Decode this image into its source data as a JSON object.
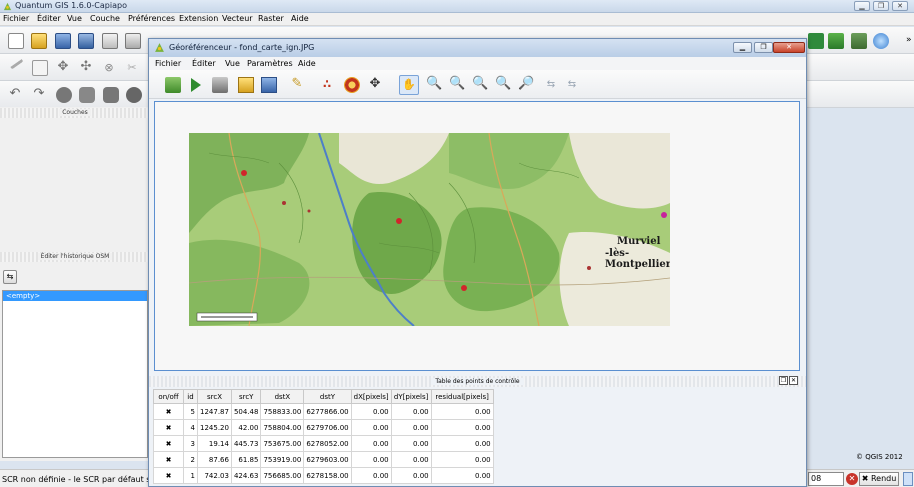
{
  "main_window": {
    "title": "Quantum GIS 1.6.0-Capiapo",
    "buttons": [
      "▁",
      "❐",
      "✕"
    ]
  },
  "main_menu": [
    "Fichier",
    "Éditer",
    "Vue",
    "Couche",
    "Préférences",
    "Extension",
    "Vecteur",
    "Raster",
    "Aide"
  ],
  "panels": {
    "layers_title": "Couches",
    "osm_title": "Éditer l'historique OSM",
    "osm_list_item": "<empty>"
  },
  "status": {
    "left_text": "SCR non définie - le SCR par défaut ser",
    "copyright": "© QGIS 2012",
    "scale_value": "08",
    "render_label": "Rendu"
  },
  "georef": {
    "title": "Géoréférenceur - fond_carte_ign.JPG",
    "menu": [
      "Fichier",
      "Éditer",
      "Vue",
      "Paramètres",
      "Aide"
    ],
    "table_title": "Table des points de contrôle",
    "columns": [
      "on/off",
      "id",
      "srcX",
      "srcY",
      "dstX",
      "dstY",
      "dX[pixels]",
      "dY[pixels]",
      "residual[pixels]"
    ],
    "rows": [
      [
        "✖",
        "5",
        "1247.87",
        "504.48",
        "758833.00",
        "6277866.00",
        "0.00",
        "0.00",
        "0.00"
      ],
      [
        "✖",
        "4",
        "1245.20",
        "42.00",
        "758804.00",
        "6279706.00",
        "0.00",
        "0.00",
        "0.00"
      ],
      [
        "✖",
        "3",
        "19.14",
        "445.73",
        "753675.00",
        "6278052.00",
        "0.00",
        "0.00",
        "0.00"
      ],
      [
        "✖",
        "2",
        "87.66",
        "61.85",
        "753919.00",
        "6279603.00",
        "0.00",
        "0.00",
        "0.00"
      ],
      [
        "✖",
        "1",
        "742.03",
        "424.63",
        "756685.00",
        "6278158.00",
        "0.00",
        "0.00",
        "0.00"
      ]
    ]
  },
  "map": {
    "town_label_1": "Murviel",
    "town_label_2": "-lès-Montpellier"
  },
  "colors": {
    "title_bar": "#c9d8ea",
    "canvas_border": "#5b8fd0",
    "forest": "#7fb25a",
    "river": "#4d7fc8",
    "gcp_marker": "#d1252b"
  }
}
